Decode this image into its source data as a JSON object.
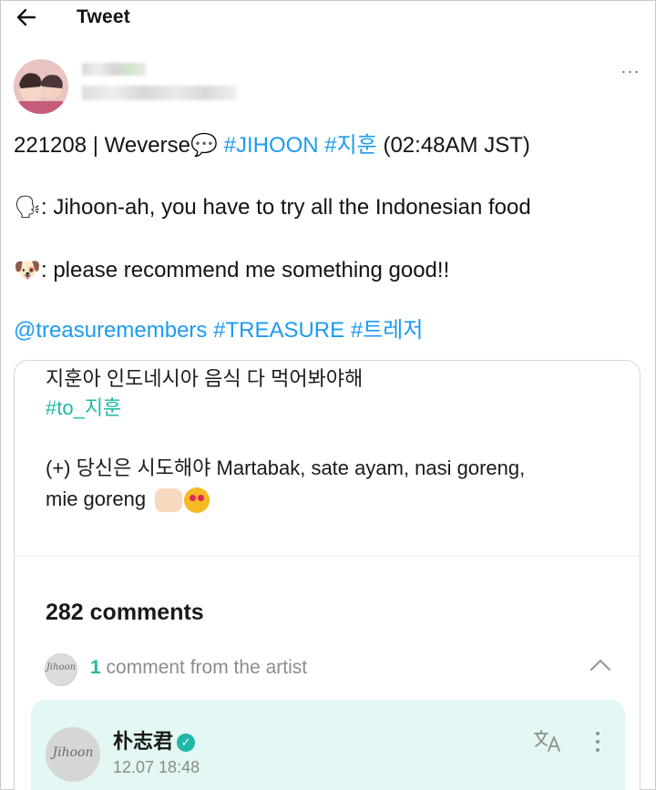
{
  "header": {
    "back_icon": "arrow-left-icon",
    "title": "Tweet"
  },
  "author": {
    "more_icon": "more-horizontal-icon",
    "more_label": "···"
  },
  "tweet": {
    "line1": {
      "prefix": "221208 | Weverse",
      "speech_emoji": "💬",
      "hashtag1": "#JIHOON",
      "hashtag2": "#지훈",
      "suffix": "(02:48AM JST)"
    },
    "line2": {
      "emoji": "🗣",
      "text": ": Jihoon-ah, you have to try all the Indonesian food"
    },
    "line3": {
      "emoji": "🐶",
      "text": ": please recommend me something good!!"
    },
    "line4": {
      "mention": "@treasuremembers",
      "hashtag1": "#TREASURE",
      "hashtag2": "#트레저"
    }
  },
  "card": {
    "post_line1": "지훈아 인도네시아 음식 다 먹어봐야해",
    "post_hashtag": "#to_지훈",
    "post_line3": "(+) 당신은 시도해야 Martabak, sate ayam, nasi goreng,",
    "post_line4": "mie goreng",
    "comments_count": "282 comments",
    "artist_comment_count": "1",
    "artist_comment_label": "comment from the artist",
    "artist": {
      "name": "朴志君",
      "time": "12.07 18:48",
      "signature": "Jihoon"
    },
    "colors": {
      "accent": "#1fb8a4",
      "artist_box": "#e3f8f4",
      "link": "#1d9bf0"
    }
  }
}
